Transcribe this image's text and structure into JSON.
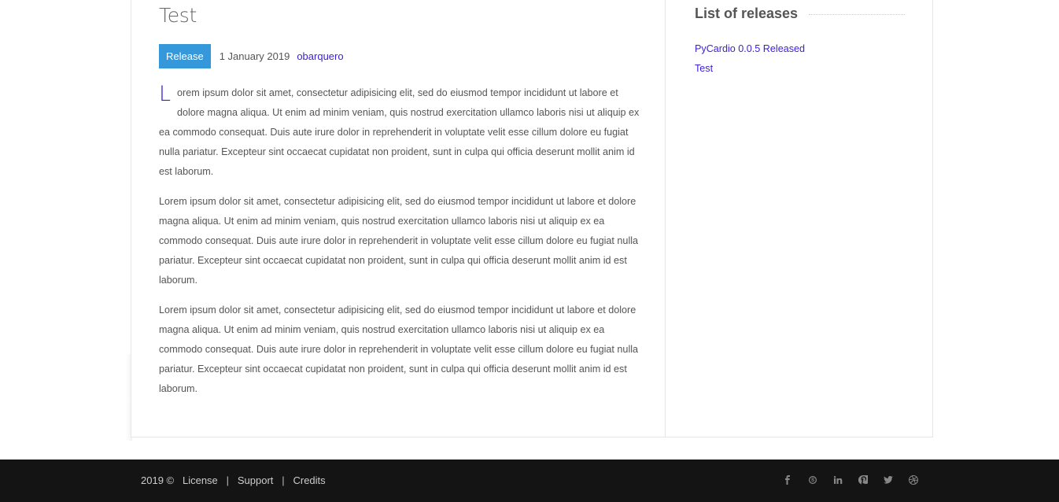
{
  "post": {
    "title": "Test",
    "category": "Release",
    "date": "1 January 2019",
    "author": "obarquero",
    "dropcap": "L",
    "paragraphs": [
      "orem ipsum dolor sit amet, consectetur adipisicing elit, sed do eiusmod tempor incididunt ut labore et dolore magna aliqua. Ut enim ad minim veniam, quis nostrud exercitation ullamco laboris nisi ut aliquip ex ea commodo consequat. Duis aute irure dolor in reprehenderit in voluptate velit esse cillum dolore eu fugiat nulla pariatur. Excepteur sint occaecat cupidatat non proident, sunt in culpa qui officia deserunt mollit anim id est laborum.",
      "Lorem ipsum dolor sit amet, consectetur adipisicing elit, sed do eiusmod tempor incididunt ut labore et dolore magna aliqua. Ut enim ad minim veniam, quis nostrud exercitation ullamco laboris nisi ut aliquip ex ea commodo consequat. Duis aute irure dolor in reprehenderit in voluptate velit esse cillum dolore eu fugiat nulla pariatur. Excepteur sint occaecat cupidatat non proident, sunt in culpa qui officia deserunt mollit anim id est laborum.",
      "Lorem ipsum dolor sit amet, consectetur adipisicing elit, sed do eiusmod tempor incididunt ut labore et dolore magna aliqua. Ut enim ad minim veniam, quis nostrud exercitation ullamco laboris nisi ut aliquip ex ea commodo consequat. Duis aute irure dolor in reprehenderit in voluptate velit esse cillum dolore eu fugiat nulla pariatur. Excepteur sint occaecat cupidatat non proident, sunt in culpa qui officia deserunt mollit anim id est laborum."
    ]
  },
  "sidebar": {
    "title": "List of releases",
    "releases": [
      "PyCardio 0.0.5 Released",
      "Test"
    ]
  },
  "footer": {
    "year": "2019 ©",
    "links": [
      "License",
      "Support",
      "Credits"
    ],
    "separator": "|",
    "social_icons": [
      "facebook-icon",
      "skype-icon",
      "linkedin-icon",
      "pinterest-icon",
      "twitter-icon",
      "dribbble-icon"
    ]
  },
  "colors": {
    "accent": "#3498db",
    "link": "#3a1fd6",
    "footer_bg": "#141414"
  }
}
